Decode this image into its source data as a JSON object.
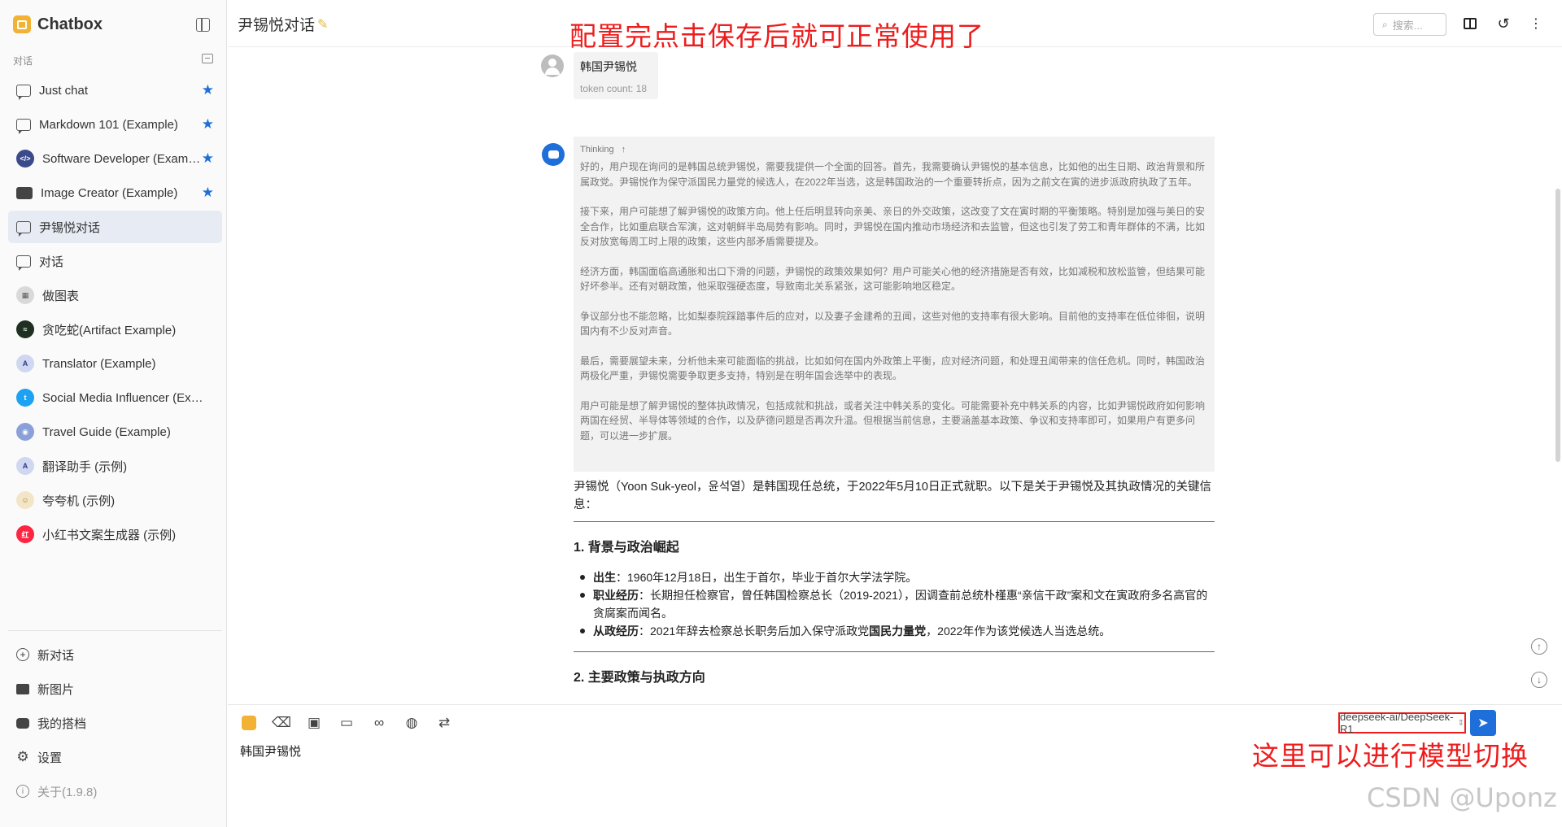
{
  "app": {
    "name": "Chatbox"
  },
  "sidebar": {
    "section_label": "对话",
    "conversations": [
      {
        "label": "Just chat",
        "starred": true,
        "icon": "chat-icon"
      },
      {
        "label": "Markdown 101 (Example)",
        "starred": true,
        "icon": "chat-icon"
      },
      {
        "label": "Software Developer (Example)",
        "starred": true,
        "icon": "developer-avatar"
      },
      {
        "label": "Image Creator (Example)",
        "starred": true,
        "icon": "image-icon"
      },
      {
        "label": "尹锡悦对话",
        "starred": false,
        "active": true,
        "icon": "chat-icon"
      },
      {
        "label": "对话",
        "starred": false,
        "icon": "chat-icon"
      },
      {
        "label": "做图表",
        "starred": false,
        "icon": "chart-avatar"
      },
      {
        "label": "贪吃蛇(Artifact Example)",
        "starred": false,
        "icon": "snake-avatar"
      },
      {
        "label": "Translator (Example)",
        "starred": false,
        "icon": "translator-avatar"
      },
      {
        "label": "Social Media Influencer (Example)",
        "starred": false,
        "icon": "twitter-avatar"
      },
      {
        "label": "Travel Guide (Example)",
        "starred": false,
        "icon": "travel-avatar"
      },
      {
        "label": "翻译助手 (示例)",
        "starred": false,
        "icon": "translator-avatar"
      },
      {
        "label": "夸夸机 (示例)",
        "starred": false,
        "icon": "praise-avatar"
      },
      {
        "label": "小红书文案生成器 (示例)",
        "starred": false,
        "icon": "xiaohongshu-avatar"
      }
    ],
    "bottom": {
      "new_chat": "新对话",
      "new_image": "新图片",
      "my_partners": "我的搭档",
      "settings": "设置",
      "about": "关于(1.9.8)"
    }
  },
  "header": {
    "title": "尹锡悦对话",
    "search_placeholder": "搜索...",
    "annotation": "配置完点击保存后就可正常使用了"
  },
  "messages": {
    "user": {
      "text": "韩国尹锡悦",
      "token_count": "token count: 18"
    },
    "assistant": {
      "thinking_label": "Thinking",
      "thinking_paragraphs": [
        "好的，用户现在询问的是韩国总统尹锡悦，需要我提供一个全面的回答。首先，我需要确认尹锡悦的基本信息，比如他的出生日期、政治背景和所属政党。尹锡悦作为保守派国民力量党的候选人，在2022年当选，这是韩国政治的一个重要转折点，因为之前文在寅的进步派政府执政了五年。",
        "接下来，用户可能想了解尹锡悦的政策方向。他上任后明显转向亲美、亲日的外交政策，这改变了文在寅时期的平衡策略。特别是加强与美日的安全合作，比如重启联合军演，这对朝鲜半岛局势有影响。同时，尹锡悦在国内推动市场经济和去监管，但这也引发了劳工和青年群体的不满，比如反对放宽每周工时上限的政策，这些内部矛盾需要提及。",
        "经济方面，韩国面临高通胀和出口下滑的问题，尹锡悦的政策效果如何？用户可能关心他的经济措施是否有效，比如减税和放松监管，但结果可能好坏参半。还有对朝政策，他采取强硬态度，导致南北关系紧张，这可能影响地区稳定。",
        "争议部分也不能忽略，比如梨泰院踩踏事件后的应对，以及妻子金建希的丑闻，这些对他的支持率有很大影响。目前他的支持率在低位徘徊，说明国内有不少反对声音。",
        "最后，需要展望未来，分析他未来可能面临的挑战，比如如何在国内外政策上平衡，应对经济问题，和处理丑闻带来的信任危机。同时，韩国政治两极化严重，尹锡悦需要争取更多支持，特别是在明年国会选举中的表现。",
        "用户可能是想了解尹锡悦的整体执政情况，包括成就和挑战，或者关注中韩关系的变化。可能需要补充中韩关系的内容，比如尹锡悦政府如何影响两国在经贸、半导体等领域的合作，以及萨德问题是否再次升温。但根据当前信息，主要涵盖基本政策、争议和支持率即可，如果用户有更多问题，可以进一步扩展。"
      ],
      "intro": "尹锡悦（Yoon Suk-yeol，윤석열）是韩国现任总统，于2022年5月10日正式就职。以下是关于尹锡悦及其执政情况的关键信息：",
      "section1_title": "1. 背景与政治崛起",
      "section1_items": [
        {
          "label": "出生",
          "text": "：1960年12月18日，出生于首尔，毕业于首尔大学法学院。"
        },
        {
          "label": "职业经历",
          "text": "：长期担任检察官，曾任韩国检察总长（2019-2021），因调查前总统朴槿惠“亲信干政”案和文在寅政府多名高官的贪腐案而闻名。"
        },
        {
          "label": "从政经历",
          "text": "：2021年辞去检察总长职务后加入保守派政党",
          "bold": "国民力量党",
          "tail": "，2022年作为该党候选人当选总统。"
        }
      ],
      "section2_title": "2. 主要政策与执政方向"
    }
  },
  "input": {
    "text": "韩国尹锡悦",
    "model": "deepseek-ai/DeepSeek-R1",
    "annotation": "这里可以进行模型切换",
    "watermark": "CSDN @Uponz"
  },
  "colors": {
    "accent": "#1e6fd9",
    "annotation_red": "#ee1c1c",
    "logo": "#f2b233"
  }
}
